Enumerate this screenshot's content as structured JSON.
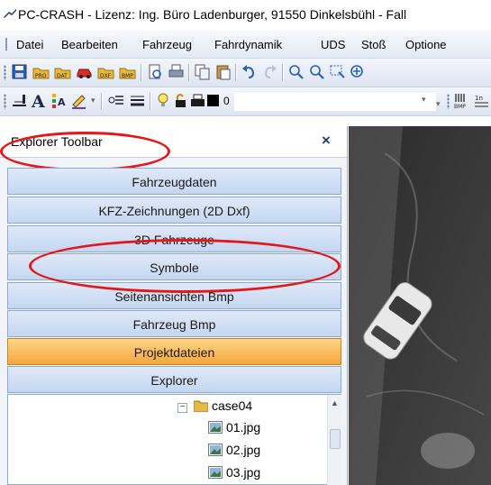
{
  "window": {
    "title": "PC-CRASH - Lizenz: Ing. Büro Ladenburger, 91550 Dinkelsbühl - Fall"
  },
  "menu": [
    "Datei",
    "Bearbeiten",
    "Fahrzeug",
    "Fahrdynamik",
    "UDS",
    "Stoß",
    "Optione"
  ],
  "toolbar": {
    "line_width_value": "0"
  },
  "explorer": {
    "title": "Explorer Toolbar",
    "close_label": "×",
    "buttons": [
      "Fahrzeugdaten",
      "KFZ-Zeichnungen (2D Dxf)",
      "3D Fahrzeuge",
      "Symbole",
      "Seitenansichten Bmp",
      "Fahrzeug Bmp",
      "Projektdateien",
      "Explorer"
    ],
    "active_button": "Projektdateien",
    "tree": {
      "folder": "case04",
      "files": [
        "01.jpg",
        "02.jpg",
        "03.jpg"
      ]
    }
  },
  "colors": {
    "highlight": "#e3171a",
    "active_button": "#f3a73a",
    "nav_button": "#c4d6f0"
  }
}
